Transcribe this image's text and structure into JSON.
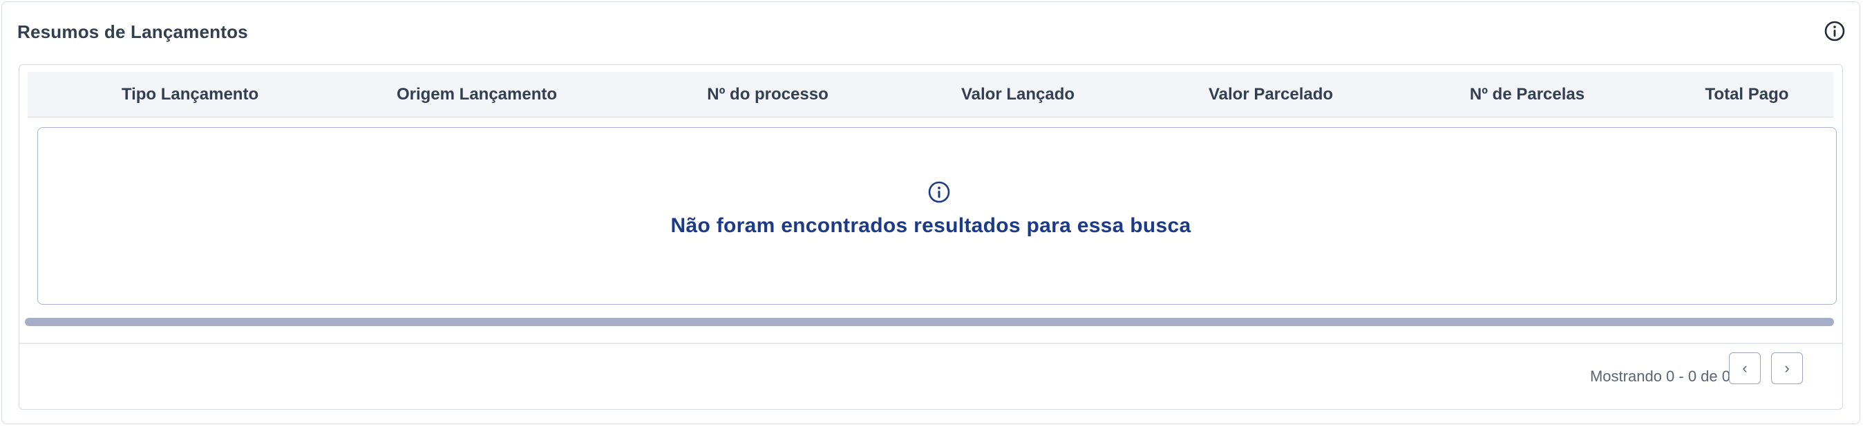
{
  "panel": {
    "title": "Resumos de Lançamentos",
    "info_icon": "info-circle-icon"
  },
  "table": {
    "columns": [
      "Tipo Lançamento",
      "Origem Lançamento",
      "Nº do processo",
      "Valor Lançado",
      "Valor Parcelado",
      "Nº de Parcelas",
      "Total Pago"
    ],
    "rows": [],
    "empty_state": {
      "icon": "info-circle-icon",
      "message": "Não foram encontrados resultados para essa busca"
    }
  },
  "pagination": {
    "status_text": "Mostrando 0 - 0 de 0",
    "prev_label": "‹",
    "next_label": "›"
  },
  "colors": {
    "title_text": "#333f51",
    "empty_message": "#1b3a8a",
    "border": "#d6dbe6",
    "header_bg": "#f3f5f9",
    "scrollbar": "#a7aec8"
  }
}
